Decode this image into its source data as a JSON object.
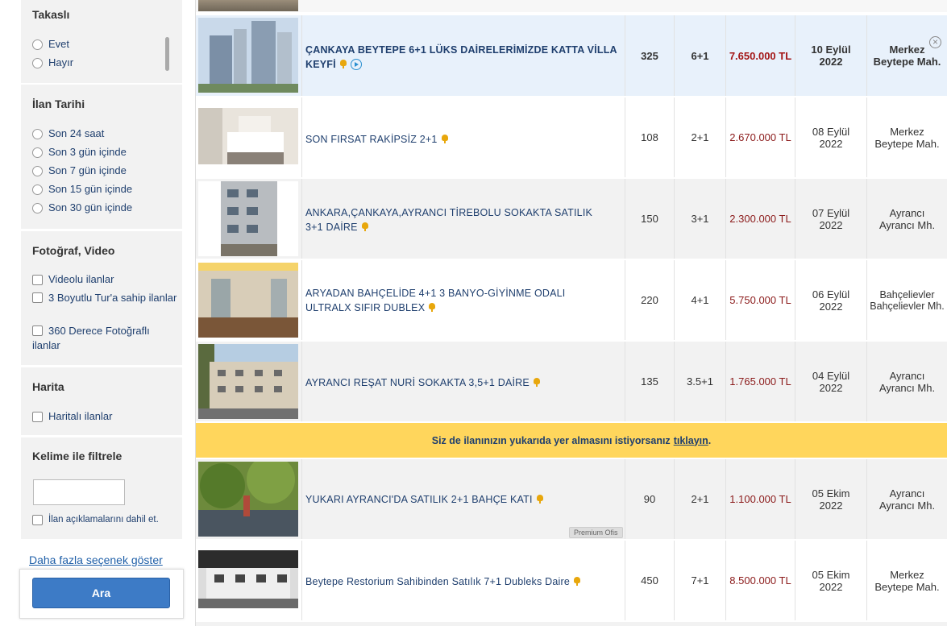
{
  "filters": {
    "takasli": {
      "title": "Takaslı",
      "options": [
        "Evet",
        "Hayır"
      ]
    },
    "ilan_tarihi": {
      "title": "İlan Tarihi",
      "options": [
        "Son 24 saat",
        "Son 3 gün içinde",
        "Son 7 gün içinde",
        "Son 15 gün içinde",
        "Son 30 gün içinde"
      ]
    },
    "foto_video": {
      "title": "Fotoğraf, Video",
      "options": [
        "Videolu ilanlar",
        "3 Boyutlu Tur'a sahip ilanlar",
        "360 Derece Fotoğraflı ilanlar"
      ]
    },
    "harita": {
      "title": "Harita",
      "options": [
        "Haritalı ilanlar"
      ]
    },
    "kelime": {
      "title": "Kelime ile filtrele",
      "input_value": "",
      "checkbox_label": "İlan açıklamalarını dahil et."
    }
  },
  "more_options": "Daha fazla seçenek göster",
  "search_button": "Ara",
  "promo": {
    "text": "Siz de ilanınızın yukarıda yer almasını istiyorsanız",
    "link": "tıklayın",
    "suffix": "."
  },
  "colors": {
    "accent": "#3d7bc6",
    "promo_bg": "#ffd65c",
    "price": "#8b1a1a",
    "highlight_row": "#e8f1fb"
  },
  "listings": [
    {
      "title": "ÇANKAYA BEYTEPE 6+1 LÜKS DAİRELERİMİZDE KATTA VİLLA KEYFİ",
      "m2": "325",
      "rooms": "6+1",
      "price": "7.650.000 TL",
      "date1": "10 Eylül",
      "date2": "2022",
      "loc1": "Merkez",
      "loc2": "Beytepe Mah.",
      "has_video": true,
      "badge": ""
    },
    {
      "title": "SON FIRSAT RAKİPSİZ 2+1",
      "m2": "108",
      "rooms": "2+1",
      "price": "2.670.000 TL",
      "date1": "08 Eylül",
      "date2": "2022",
      "loc1": "Merkez",
      "loc2": "Beytepe Mah.",
      "has_video": false,
      "badge": ""
    },
    {
      "title": "ANKARA,ÇANKAYA,AYRANCI TİREBOLU SOKAKTA SATILIK 3+1 DAİRE",
      "m2": "150",
      "rooms": "3+1",
      "price": "2.300.000 TL",
      "date1": "07 Eylül",
      "date2": "2022",
      "loc1": "Ayrancı",
      "loc2": "Ayrancı Mh.",
      "has_video": false,
      "badge": ""
    },
    {
      "title": "ARYADAN BAHÇELİDE 4+1 3 BANYO-GİYİNME ODALI ULTRALX SIFIR DUBLEX",
      "m2": "220",
      "rooms": "4+1",
      "price": "5.750.000 TL",
      "date1": "06 Eylül",
      "date2": "2022",
      "loc1": "Bahçelievler",
      "loc2": "Bahçelievler Mh.",
      "has_video": false,
      "badge": ""
    },
    {
      "title": "AYRANCI REŞAT NURİ SOKAKTA 3,5+1 DAİRE",
      "m2": "135",
      "rooms": "3.5+1",
      "price": "1.765.000 TL",
      "date1": "04 Eylül",
      "date2": "2022",
      "loc1": "Ayrancı",
      "loc2": "Ayrancı Mh.",
      "has_video": false,
      "badge": ""
    },
    {
      "title": "YUKARI AYRANCI'DA SATILIK 2+1 BAHÇE KATI",
      "m2": "90",
      "rooms": "2+1",
      "price": "1.100.000 TL",
      "date1": "05 Ekim",
      "date2": "2022",
      "loc1": "Ayrancı",
      "loc2": "Ayrancı Mh.",
      "has_video": false,
      "badge": "Premium Ofis"
    },
    {
      "title": "Beytepe Restorium Sahibinden Satılık 7+1 Dubleks Daire",
      "m2": "450",
      "rooms": "7+1",
      "price": "8.500.000 TL",
      "date1": "05 Ekim",
      "date2": "2022",
      "loc1": "Merkez",
      "loc2": "Beytepe Mah.",
      "has_video": false,
      "badge": ""
    }
  ],
  "close_symbol": "×"
}
